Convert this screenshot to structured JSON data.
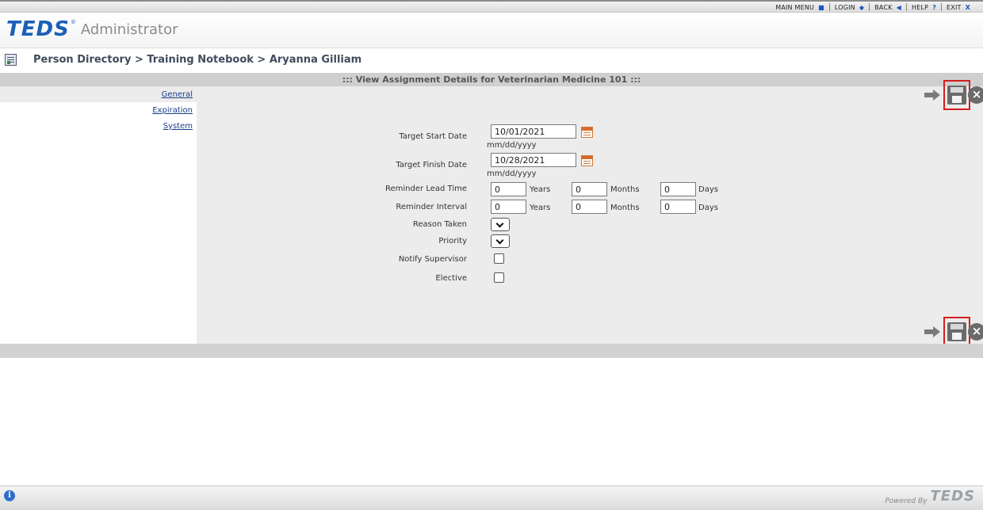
{
  "topnav": {
    "items": [
      {
        "label": "MAIN MENU",
        "glyph": "■"
      },
      {
        "label": "LOGIN",
        "glyph": "◆"
      },
      {
        "label": "BACK",
        "glyph": "◀"
      },
      {
        "label": "HELP",
        "glyph": "?"
      },
      {
        "label": "EXIT",
        "glyph": "X"
      }
    ]
  },
  "header": {
    "logo": "TEDS",
    "logo_mark": "®",
    "subtitle": "Administrator"
  },
  "breadcrumb": "Person Directory > Training Notebook > Aryanna Gilliam",
  "section_title": "::: View Assignment Details for Veterinarian Medicine 101 :::",
  "sidebar": {
    "items": [
      {
        "label": "General"
      },
      {
        "label": "Expiration"
      },
      {
        "label": "System"
      }
    ]
  },
  "form": {
    "target_start_date": {
      "label": "Target Start Date",
      "value": "10/01/2021",
      "hint": "mm/dd/yyyy"
    },
    "target_finish_date": {
      "label": "Target Finish Date",
      "value": "10/28/2021",
      "hint": "mm/dd/yyyy"
    },
    "reminder_lead_time": {
      "label": "Reminder Lead Time",
      "years": "0",
      "months": "0",
      "days": "0"
    },
    "reminder_interval": {
      "label": "Reminder Interval",
      "years": "0",
      "months": "0",
      "days": "0"
    },
    "units": {
      "years": "Years",
      "months": "Months",
      "days": "Days"
    },
    "reason_taken": {
      "label": "Reason Taken",
      "value": ""
    },
    "priority": {
      "label": "Priority",
      "value": ""
    },
    "notify_supervisor": {
      "label": "Notify Supervisor",
      "checked": false
    },
    "elective": {
      "label": "Elective",
      "checked": false
    }
  },
  "footer": {
    "powered_by": "Powered By",
    "logo": "TEDS"
  },
  "colors": {
    "accent": "#1b5fb8",
    "highlight": "#d41f1f",
    "panel": "#ececec"
  }
}
